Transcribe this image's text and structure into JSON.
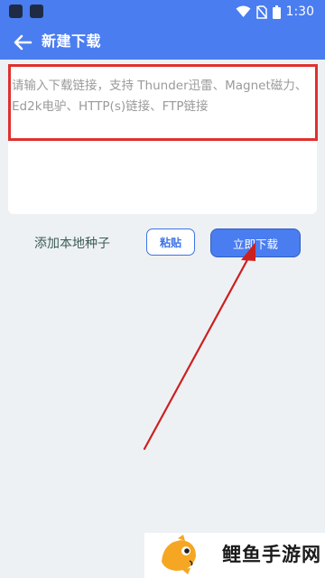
{
  "status_bar": {
    "time": "1:30",
    "icons": [
      "app-icon",
      "app-icon",
      "wifi-icon",
      "no-sim-icon",
      "battery-icon"
    ]
  },
  "app_bar": {
    "title": "新建下载",
    "back_icon": "back-arrow-icon",
    "background": "#4a7df0"
  },
  "input": {
    "value": "",
    "placeholder": "请输入下载链接，支持 Thunder迅雷、Magnet磁力、Ed2k电驴、HTTP(s)链接、FTP链接"
  },
  "actions": {
    "add_seed_label": "添加本地种子",
    "paste_label": "粘贴",
    "download_label": "立即下载",
    "accent": "#4a7df0"
  },
  "annotations": {
    "highlight_color": "#e0312e",
    "arrow_color": "#cc2020"
  },
  "watermark": {
    "logo_icon": "carp-fish-logo",
    "text": "鲤鱼手游网"
  }
}
